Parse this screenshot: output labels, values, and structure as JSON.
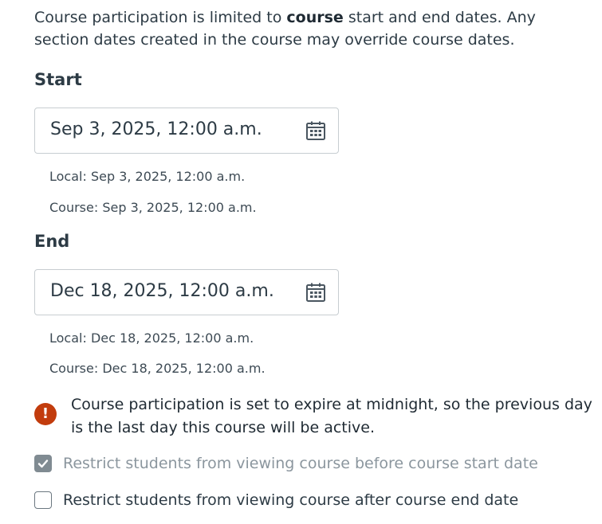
{
  "intro": {
    "prefix": "Course participation is limited to ",
    "bold": "course",
    "suffix": " start and end dates. Any section dates created in the course may override course dates."
  },
  "start": {
    "label": "Start",
    "value": "Sep 3, 2025, 12:00 a.m.",
    "local": "Local: Sep 3, 2025, 12:00 a.m.",
    "course": "Course: Sep 3, 2025, 12:00 a.m."
  },
  "end": {
    "label": "End",
    "value": "Dec 18, 2025, 12:00 a.m.",
    "local": "Local: Dec 18, 2025, 12:00 a.m.",
    "course": "Course: Dec 18, 2025, 12:00 a.m."
  },
  "warning": {
    "icon": "!",
    "text": "Course participation is set to expire at midnight, so the previous day is the last day this course will be active."
  },
  "options": {
    "restrict_before": {
      "label": "Restrict students from viewing course before course start date",
      "checked": true,
      "disabled": true
    },
    "restrict_after": {
      "label": "Restrict students from viewing course after course end date",
      "checked": false,
      "disabled": false
    }
  },
  "icons": {
    "calendar": "calendar-icon",
    "warning": "warning-icon",
    "check": "checkmark-icon"
  },
  "colors": {
    "text": "#2d3b45",
    "warning": "#c23c0d",
    "border": "#c7cdd1",
    "disabled": "#8b969e"
  }
}
